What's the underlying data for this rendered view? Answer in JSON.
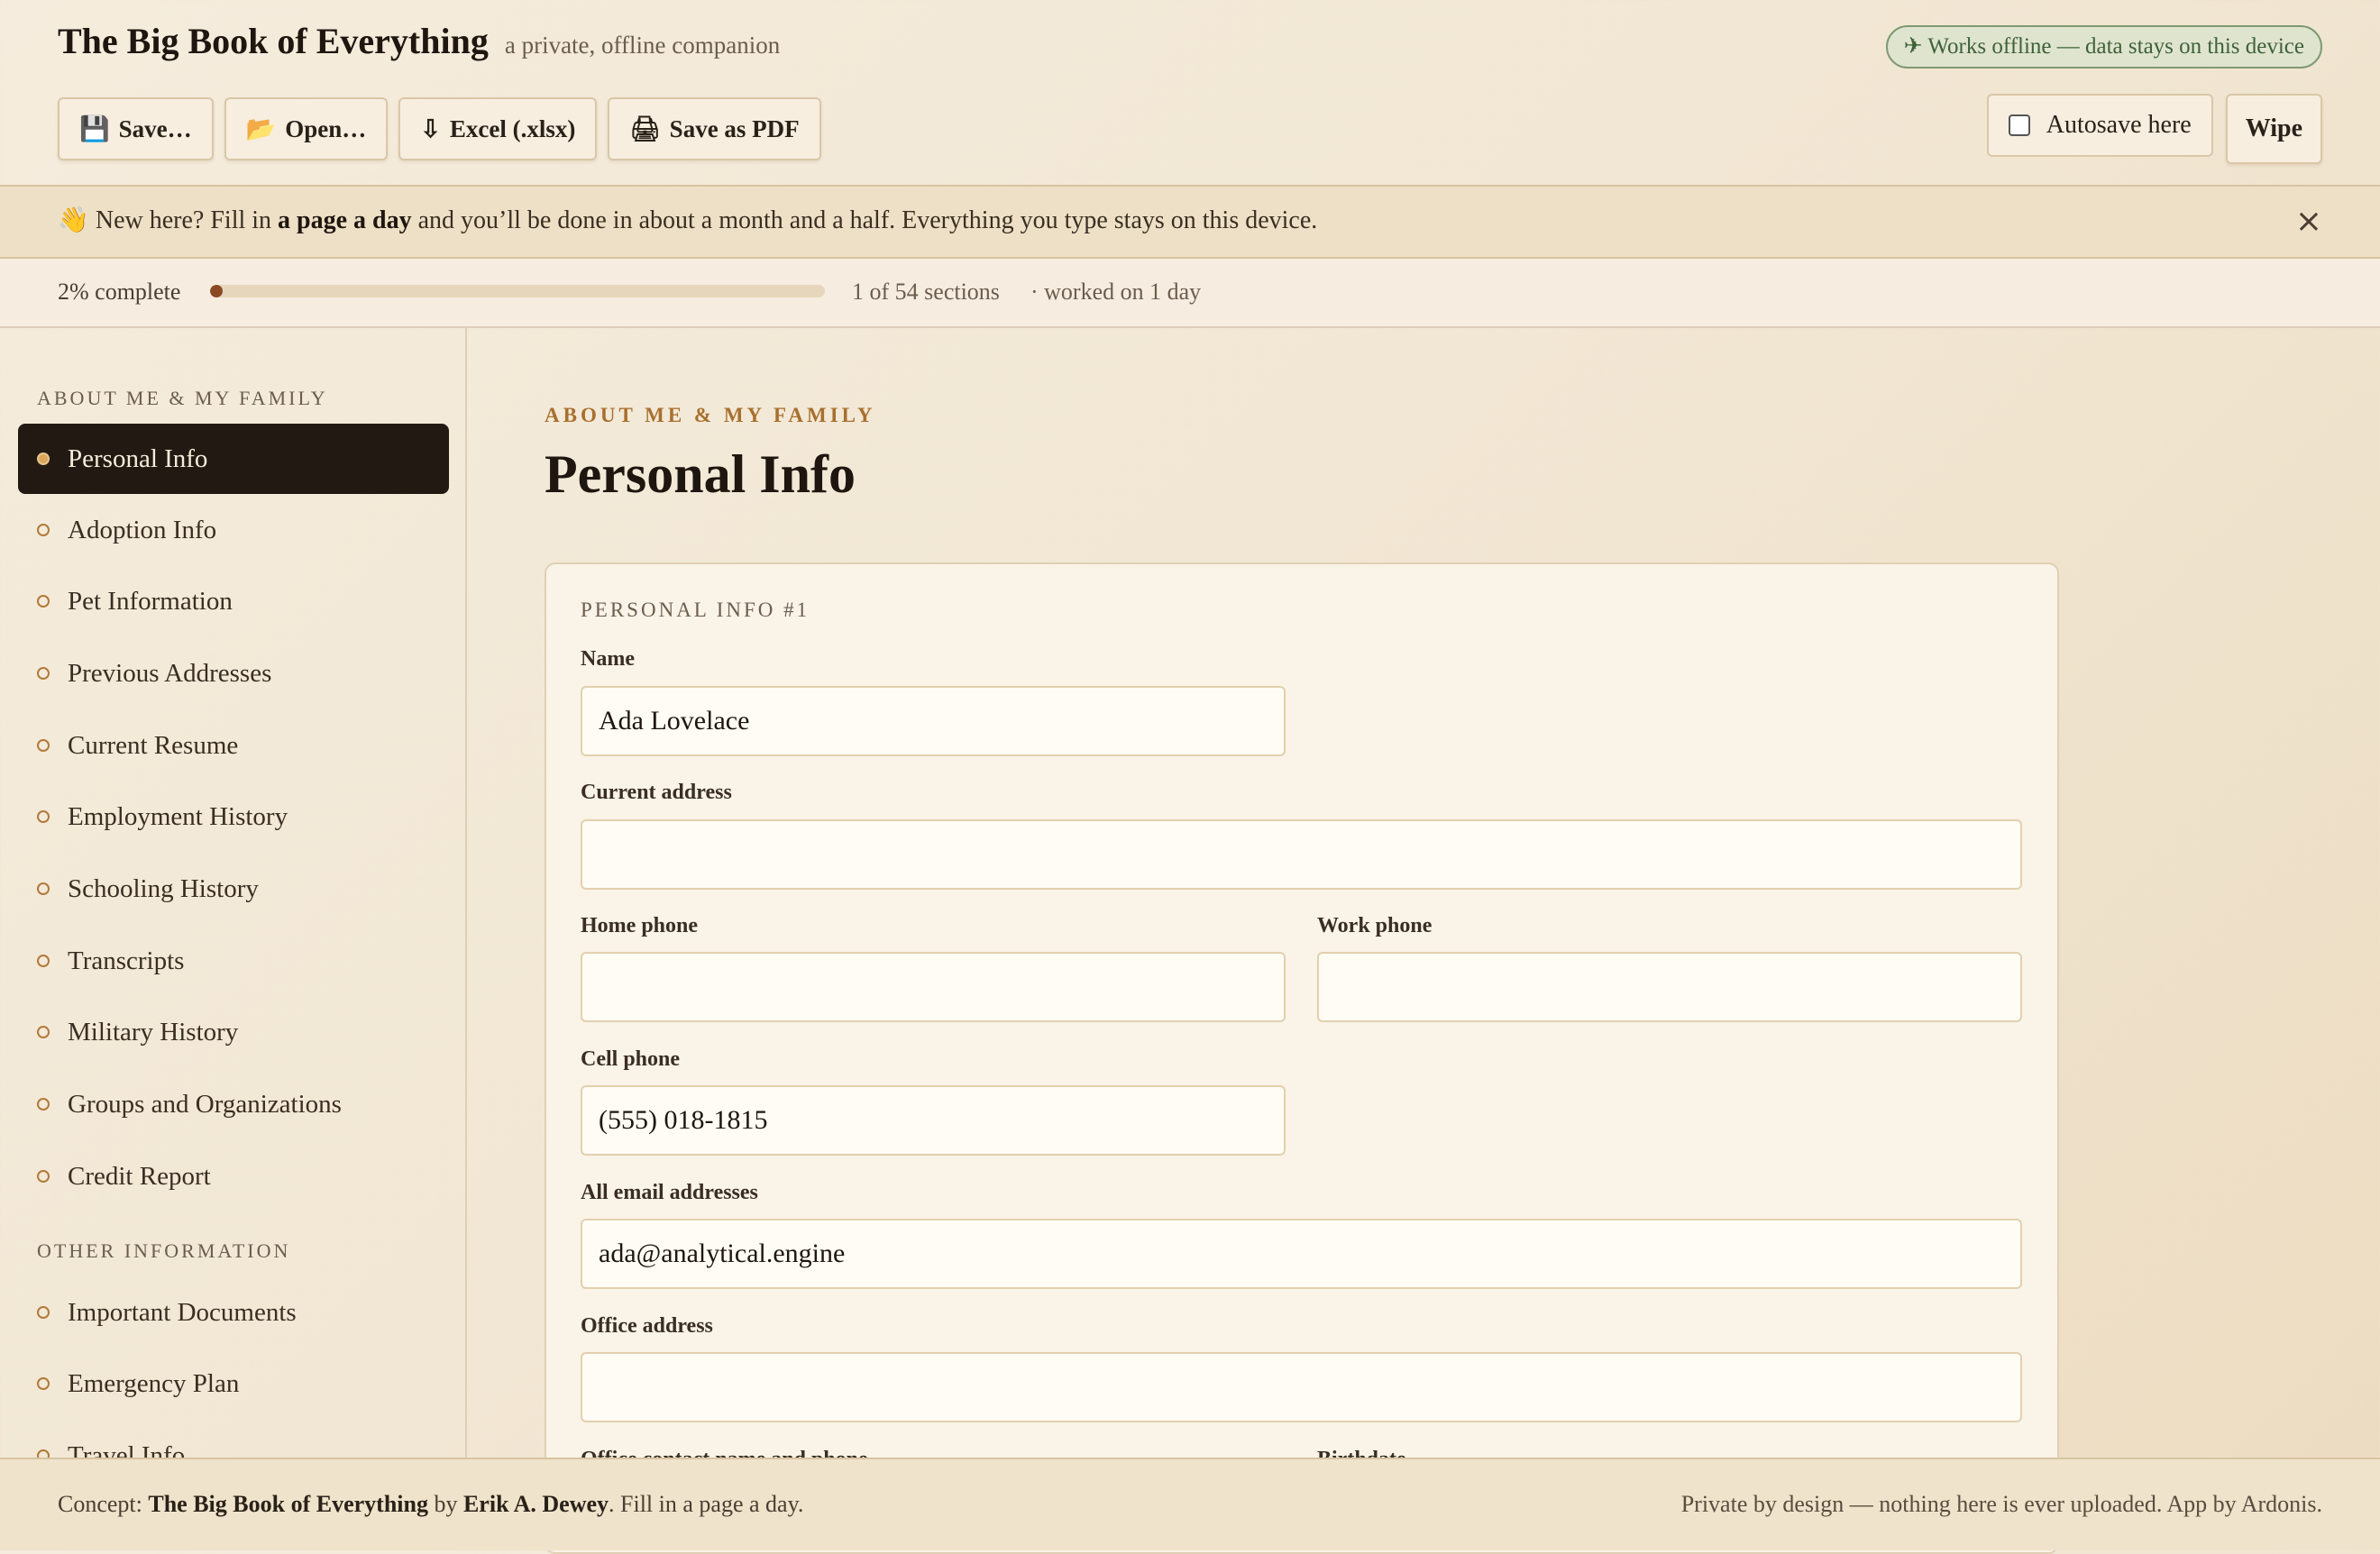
{
  "header": {
    "title": "The Big Book of Everything",
    "subtitle": "a private, offline companion",
    "offline_badge": "✈ Works offline — data stays on this device",
    "toolbar": [
      {
        "icon": "💾",
        "icon_name": "floppy-disk-icon",
        "label": "Save…"
      },
      {
        "icon": "📂",
        "icon_name": "open-folder-icon",
        "label": "Open…"
      },
      {
        "icon": "⇩",
        "icon_name": "download-arrow-icon",
        "label": "Excel (.xlsx)"
      },
      {
        "icon": "🖨",
        "icon_name": "printer-icon",
        "label": "Save as PDF"
      }
    ],
    "autosave_label": "Autosave here",
    "autosave_checked": false,
    "wipe_label": "Wipe"
  },
  "banner": {
    "emoji": "👋",
    "text_before": "New here? Fill in ",
    "text_bold": "a page a day",
    "text_after": " and you’ll be done in about a month and a half. Everything you type stays on this device.",
    "close": "×"
  },
  "progress": {
    "percent_label": "2% complete",
    "fraction": 0.02,
    "sections_label": "1 of 54 sections",
    "days_label": "· worked on 1 day"
  },
  "sidebar": {
    "groups": [
      {
        "title": "ABOUT ME & MY FAMILY",
        "items": [
          {
            "label": "Personal Info",
            "active": true
          },
          {
            "label": "Adoption Info"
          },
          {
            "label": "Pet Information"
          },
          {
            "label": "Previous Addresses"
          },
          {
            "label": "Current Resume"
          },
          {
            "label": "Employment History"
          },
          {
            "label": "Schooling History"
          },
          {
            "label": "Transcripts"
          },
          {
            "label": "Military History"
          },
          {
            "label": "Groups and Organizations"
          },
          {
            "label": "Credit Report"
          }
        ]
      },
      {
        "title": "OTHER INFORMATION",
        "items": [
          {
            "label": "Important Documents"
          },
          {
            "label": "Emergency Plan"
          },
          {
            "label": "Travel Info"
          }
        ]
      }
    ]
  },
  "main": {
    "kicker": "ABOUT ME & MY FAMILY",
    "title": "Personal Info",
    "card_title": "PERSONAL INFO #1",
    "fields": {
      "name": {
        "label": "Name",
        "value": "Ada Lovelace"
      },
      "current_address": {
        "label": "Current address",
        "value": ""
      },
      "home_phone": {
        "label": "Home phone",
        "value": ""
      },
      "work_phone": {
        "label": "Work phone",
        "value": ""
      },
      "cell_phone": {
        "label": "Cell phone",
        "value": "(555) 018-1815"
      },
      "emails": {
        "label": "All email addresses",
        "value": "ada@analytical.engine"
      },
      "office_address": {
        "label": "Office address",
        "value": ""
      },
      "office_contact": {
        "label": "Office contact name and phone",
        "value": ""
      },
      "birthdate": {
        "label": "Birthdate",
        "value": ""
      }
    }
  },
  "footer": {
    "concept_prefix": "Concept: ",
    "book": "The Big Book of Everything",
    "by": " by ",
    "author": "Erik A. Dewey",
    "suffix": ". Fill in a page a day.",
    "right": "Private by design — nothing here is ever uploaded. App by Ardonis."
  },
  "colors": {
    "accent": "#a8702e",
    "active_nav_bg": "#221a12",
    "progress_fill": "#8a4a24",
    "offline_badge": "#3e6138"
  }
}
